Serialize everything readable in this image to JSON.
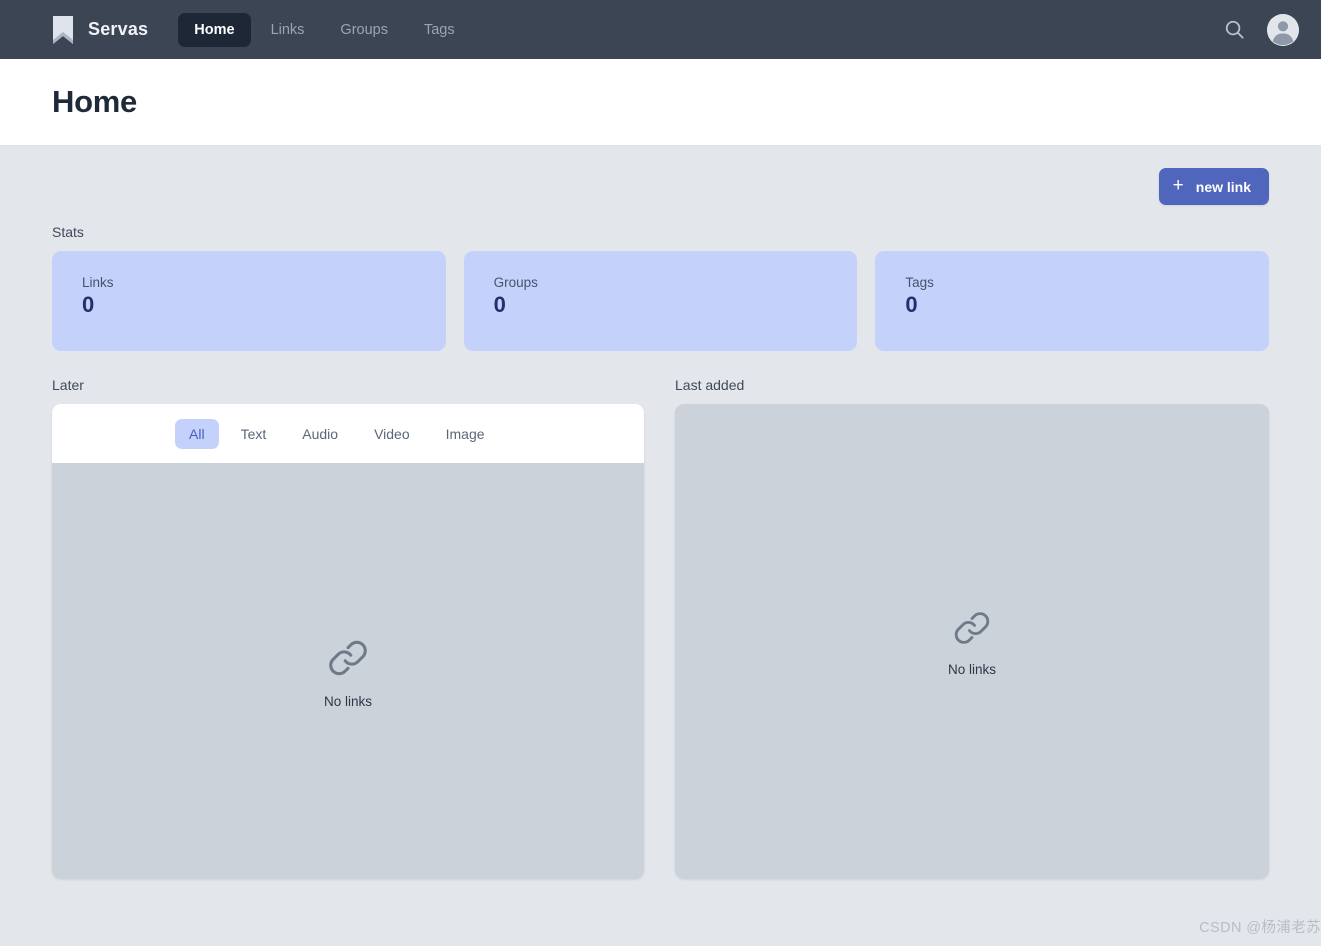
{
  "navbar": {
    "brand": {
      "name": "Servas",
      "logo_icon": "bookmark-icon"
    },
    "items": [
      {
        "label": "Home",
        "active": true
      },
      {
        "label": "Links",
        "active": false
      },
      {
        "label": "Groups",
        "active": false
      },
      {
        "label": "Tags",
        "active": false
      }
    ],
    "search_icon": "search-icon",
    "avatar_icon": "user-avatar-icon",
    "bg_color": "#3b4553",
    "active_pill_color": "#1d2735"
  },
  "header": {
    "title": "Home"
  },
  "toolbar": {
    "new_link_label": "new link",
    "new_link_icon": "plus-icon",
    "accent_color": "#5065bc"
  },
  "stats": {
    "label": "Stats",
    "card_bg": "#c4d2fb",
    "cards": [
      {
        "name": "Links",
        "value": "0"
      },
      {
        "name": "Groups",
        "value": "0"
      },
      {
        "name": "Tags",
        "value": "0"
      }
    ]
  },
  "later": {
    "label": "Later",
    "filters": [
      {
        "label": "All",
        "active": true
      },
      {
        "label": "Text",
        "active": false
      },
      {
        "label": "Audio",
        "active": false
      },
      {
        "label": "Video",
        "active": false
      },
      {
        "label": "Image",
        "active": false
      }
    ],
    "empty": {
      "icon": "chain-link-icon",
      "text": "No links"
    }
  },
  "last_added": {
    "label": "Last added",
    "empty": {
      "icon": "chain-link-icon",
      "text": "No links"
    }
  },
  "watermark": {
    "text": "CSDN @杨浦老苏"
  }
}
